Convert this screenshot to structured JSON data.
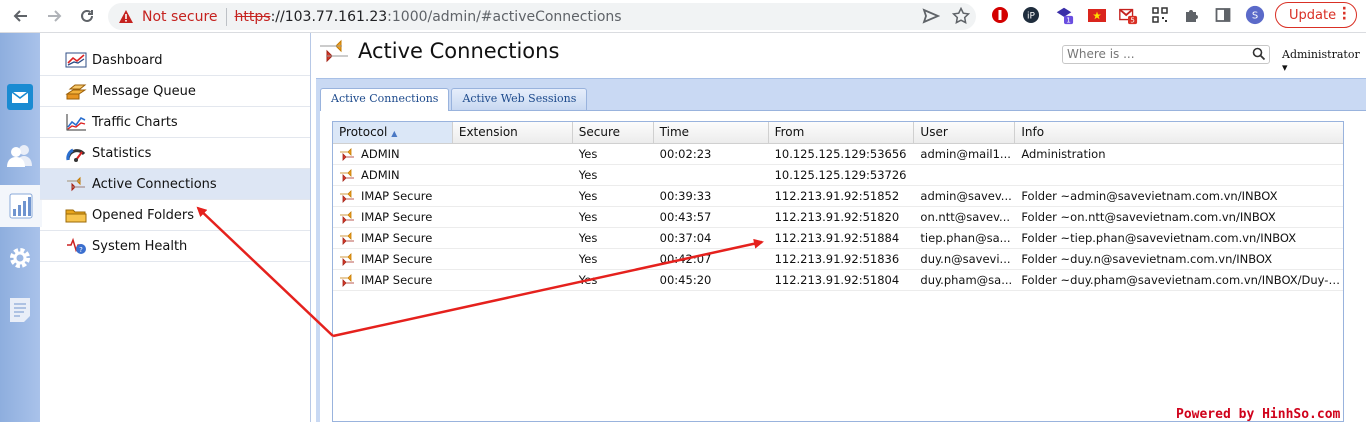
{
  "browser": {
    "security_text": "Not secure",
    "url_scheme": "https",
    "url_host": "://103.77.161.23",
    "url_rest": ":1000/admin/#activeConnections",
    "update_label": "Update",
    "profile_initial": "S",
    "ext_badge_1": "1",
    "ext_badge_2": "5"
  },
  "strip": {
    "items": [
      "mail-icon",
      "users-icon",
      "chart-icon",
      "gear-icon",
      "notes-icon"
    ],
    "active_index": 2
  },
  "nav": {
    "items": [
      {
        "label": "Dashboard",
        "icon": "dashboard-icon"
      },
      {
        "label": "Message Queue",
        "icon": "message-queue-icon"
      },
      {
        "label": "Traffic Charts",
        "icon": "traffic-charts-icon"
      },
      {
        "label": "Statistics",
        "icon": "statistics-icon"
      },
      {
        "label": "Active Connections",
        "icon": "active-connections-icon"
      },
      {
        "label": "Opened Folders",
        "icon": "folder-icon"
      },
      {
        "label": "System Health",
        "icon": "system-health-icon"
      }
    ],
    "active_index": 4
  },
  "header": {
    "title": "Active Connections",
    "search_placeholder": "Where is ...",
    "user_menu": "Administrator"
  },
  "tabs": [
    {
      "label": "Active Connections",
      "active": true
    },
    {
      "label": "Active Web Sessions",
      "active": false
    }
  ],
  "table": {
    "columns": [
      "Protocol",
      "Extension",
      "Secure",
      "Time",
      "From",
      "User",
      "Info"
    ],
    "sort_column": "Protocol",
    "rows": [
      [
        "ADMIN",
        "",
        "Yes",
        "00:02:23",
        "10.125.125.129:53656",
        "admin@mail1...",
        "Administration"
      ],
      [
        "ADMIN",
        "",
        "Yes",
        "",
        "10.125.125.129:53726",
        "",
        ""
      ],
      [
        "IMAP Secure",
        "",
        "Yes",
        "00:39:33",
        "112.213.91.92:51852",
        "admin@savev...",
        "Folder ~admin@savevietnam.com.vn/INBOX"
      ],
      [
        "IMAP Secure",
        "",
        "Yes",
        "00:43:57",
        "112.213.91.92:51820",
        "on.ntt@savev...",
        "Folder ~on.ntt@savevietnam.com.vn/INBOX"
      ],
      [
        "IMAP Secure",
        "",
        "Yes",
        "00:37:04",
        "112.213.91.92:51884",
        "tiep.phan@sa...",
        "Folder ~tiep.phan@savevietnam.com.vn/INBOX"
      ],
      [
        "IMAP Secure",
        "",
        "Yes",
        "00:42:07",
        "112.213.91.92:51836",
        "duy.n@savevi...",
        "Folder ~duy.n@savevietnam.com.vn/INBOX"
      ],
      [
        "IMAP Secure",
        "",
        "Yes",
        "00:45:20",
        "112.213.91.92:51804",
        "duy.pham@sa...",
        "Folder ~duy.pham@savevietnam.com.vn/INBOX/Duy-Sales"
      ]
    ]
  },
  "watermark": "Powered by HinhSo.com",
  "colors": {
    "annotation": "#e5211d",
    "panel": "#c9d9f3",
    "strip": "#a9c2ea"
  }
}
